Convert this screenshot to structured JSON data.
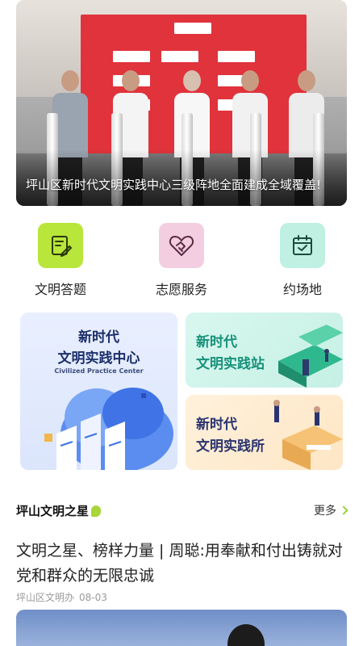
{
  "banner": {
    "caption": "坪山区新时代文明实践中心三级阵地全面建成全域覆盖!"
  },
  "quick_entries": [
    {
      "label": "文明答题",
      "icon": "quiz-icon",
      "bg": "#b8e63b",
      "fg": "#2c3a0a"
    },
    {
      "label": "志愿服务",
      "icon": "heart-handshake-icon",
      "bg": "#f3cde0",
      "fg": "#5a2c42"
    },
    {
      "label": "约场地",
      "icon": "calendar-check-icon",
      "bg": "#bff0e2",
      "fg": "#1d4a3e"
    }
  ],
  "practice": {
    "center": {
      "line1": "新时代",
      "line2": "文明实践中心",
      "sub": "Civilized Practice Center"
    },
    "station": {
      "line1": "新时代",
      "line2": "文明实践站"
    },
    "office": {
      "line1": "新时代",
      "line2": "文明实践所"
    }
  },
  "section": {
    "title": "坪山文明之星",
    "more": "更多"
  },
  "article": {
    "title": "文明之星、榜样力量 | 周聪:用奉献和付出铸就对党和群众的无限忠诚",
    "source": "坪山区文明办",
    "date": "08-03"
  },
  "colors": {
    "accent_green": "#9bd23a",
    "center_title": "#1c2f6b",
    "station_title": "#17917a",
    "office_title": "#2b3470"
  }
}
